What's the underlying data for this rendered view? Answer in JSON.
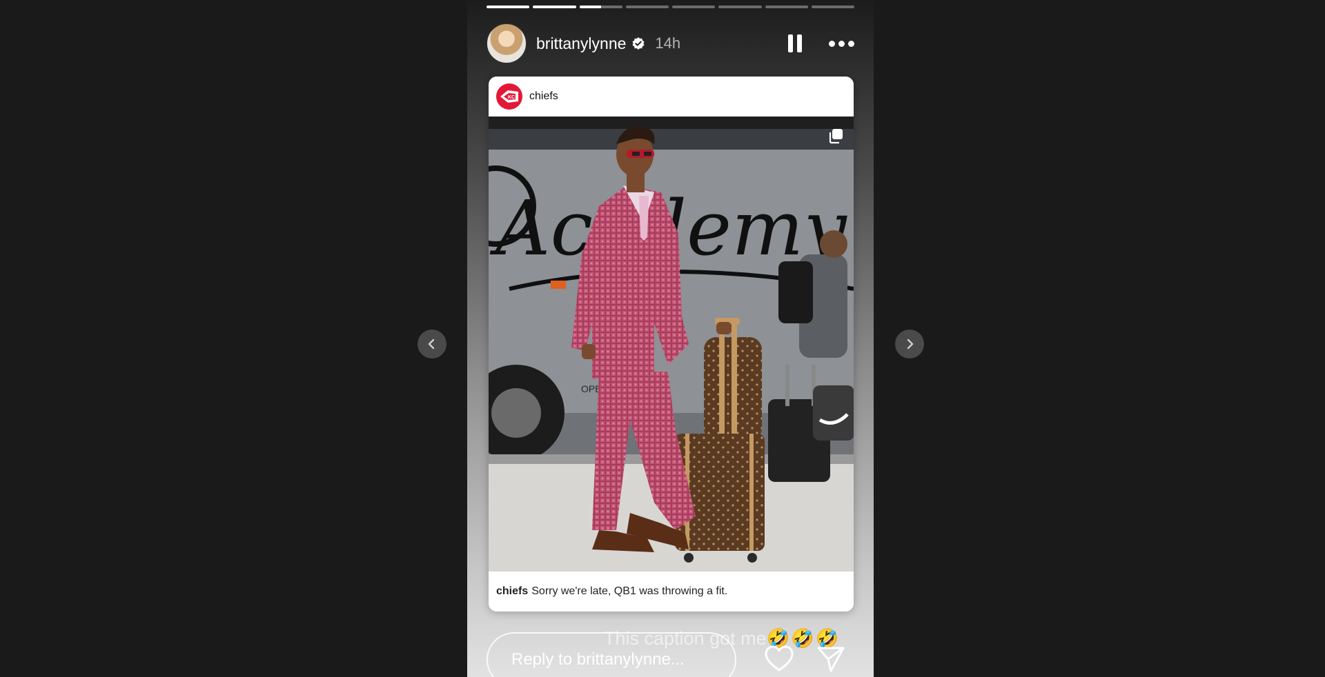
{
  "story": {
    "progress": [
      1,
      1,
      0.5,
      0,
      0,
      0,
      0,
      0
    ],
    "username": "brittanylynne",
    "time": "14h",
    "overlay_text": "This caption got me",
    "overlay_emoji": "🤣🤣🤣"
  },
  "post": {
    "username": "chiefs",
    "caption_user": "chiefs",
    "caption_text": "Sorry we're late, QB1 was throwing a fit.",
    "bus_text": "Academy",
    "bus_small_text": "OPERATED BY"
  },
  "reply": {
    "placeholder": "Reply to brittanylynne..."
  },
  "icons": {
    "verified": "verified-badge-icon",
    "pause": "pause-icon",
    "more": "more-options-icon",
    "multi": "carousel-icon",
    "heart": "heart-icon",
    "send": "send-icon",
    "prev": "chevron-left-icon",
    "next": "chevron-right-icon"
  },
  "colors": {
    "background": "#1a1a1a",
    "chiefs_red": "#e31837",
    "suit_pink": "#c45a78"
  }
}
